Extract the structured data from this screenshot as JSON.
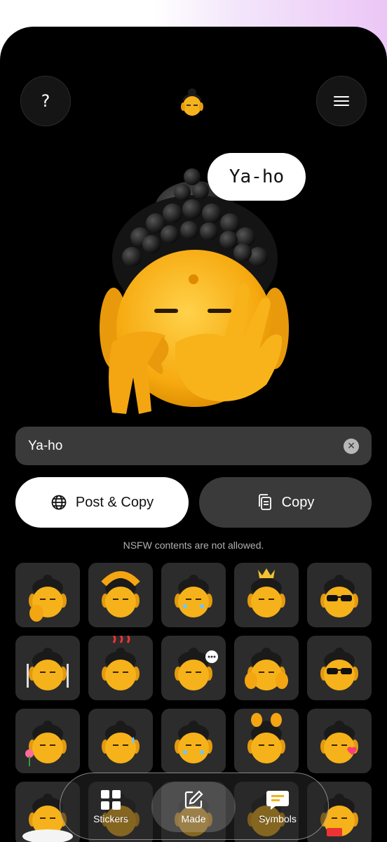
{
  "header": {
    "help_label": "?",
    "help_icon": "question-mark-icon",
    "menu_icon": "hamburger-menu-icon",
    "avatar_icon": "buddha-avatar-icon"
  },
  "preview": {
    "speech_text": "Ya-ho"
  },
  "input": {
    "value": "Ya-ho",
    "clear_icon": "clear-x-icon"
  },
  "actions": {
    "post_copy_label": "Post & Copy",
    "post_copy_icon": "globe-icon",
    "copy_label": "Copy",
    "copy_icon": "copy-documents-icon"
  },
  "notice": "NSFW contents are not allowed.",
  "stickers": [
    {
      "name": "sticker-hand-sign",
      "accessory": "hand"
    },
    {
      "name": "sticker-heart-hands",
      "accessory": "heart-hands"
    },
    {
      "name": "sticker-pleading",
      "accessory": "tears"
    },
    {
      "name": "sticker-crown",
      "accessory": "crown"
    },
    {
      "name": "sticker-sunglasses-salute",
      "accessory": "sunglasses"
    },
    {
      "name": "sticker-fork-knife",
      "accessory": "fork"
    },
    {
      "name": "sticker-hot-springs",
      "accessory": "steam"
    },
    {
      "name": "sticker-laughing-chat",
      "accessory": "chat"
    },
    {
      "name": "sticker-hands-cheeks",
      "accessory": "hands"
    },
    {
      "name": "sticker-cool-sunglasses",
      "accessory": "sunglasses"
    },
    {
      "name": "sticker-flower",
      "accessory": "flower"
    },
    {
      "name": "sticker-sweat",
      "accessory": "sweat"
    },
    {
      "name": "sticker-crying",
      "accessory": "tears"
    },
    {
      "name": "sticker-hands-up",
      "accessory": "hands-up"
    },
    {
      "name": "sticker-kiss-heart",
      "accessory": "heart"
    },
    {
      "name": "sticker-bathtub",
      "accessory": "bath"
    },
    {
      "name": "sticker-row4-2",
      "accessory": "none"
    },
    {
      "name": "sticker-row4-3",
      "accessory": "none"
    },
    {
      "name": "sticker-row4-4",
      "accessory": "none"
    },
    {
      "name": "sticker-sos",
      "accessory": "sos"
    }
  ],
  "tabbar": {
    "stickers_label": "Stickers",
    "stickers_icon": "grid-icon",
    "made_label": "Made",
    "made_icon": "edit-square-icon",
    "symbols_label": "Symbols",
    "symbols_icon": "message-symbols-icon",
    "active_tab": "Made"
  },
  "colors": {
    "background": "#000000",
    "face": "#f6b21a",
    "hair": "#1a1a1a",
    "tile": "#2c2c2c",
    "field": "#3a3a3a"
  }
}
